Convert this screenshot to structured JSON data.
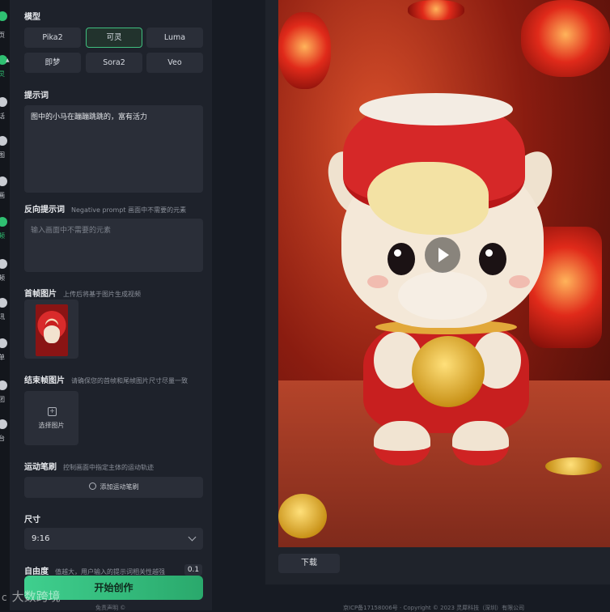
{
  "nav": {
    "items": [
      {
        "label": "页",
        "icon": "home-icon"
      },
      {
        "label": "灵",
        "icon": "video-icon",
        "active": true
      },
      {
        "label": "话",
        "icon": "chat-icon"
      },
      {
        "label": "图",
        "icon": "image-icon"
      },
      {
        "label": "画",
        "icon": "paint-icon"
      },
      {
        "label": "频",
        "icon": "film-icon",
        "active": true
      },
      {
        "label": "频",
        "icon": "audio-icon"
      },
      {
        "label": "讯",
        "icon": "news-icon"
      },
      {
        "label": "单",
        "icon": "list-icon"
      },
      {
        "label": "团",
        "icon": "team-icon"
      },
      {
        "label": "台",
        "icon": "platform-icon"
      }
    ]
  },
  "panel": {
    "model_title": "模型",
    "models": [
      "Pika2",
      "可灵",
      "Luma",
      "即梦",
      "Sora2",
      "Veo"
    ],
    "selected_model": "可灵",
    "prompt_title": "提示词",
    "prompt_value": "图中的小马在蹦蹦跳跳的，富有活力",
    "negative_title": "反向提示词",
    "negative_hint": "Negative prompt 画面中不需要的元素",
    "negative_placeholder": "输入画面中不需要的元素",
    "first_frame_title": "首帧图片",
    "first_frame_hint": "上传后将基于图片生成视频",
    "end_frame_title": "结束帧图片",
    "end_frame_hint": "请确保您的首帧和尾帧图片尺寸尽量一致",
    "upload_label": "选择图片",
    "brush_title": "运动笔刷",
    "brush_hint": "控制画面中指定主体的运动轨迹",
    "brush_button": "添加运动笔刷",
    "size_title": "尺寸",
    "size_value": "9:16",
    "freedom_title": "自由度",
    "freedom_hint": "值越大，用户输入的提示词相关性越强",
    "freedom_value": "0.1",
    "start_button": "开始创作",
    "footer_left": "免责声明 ©",
    "footer_right": "京ICP备17158006号 · Copyright © 2023 灵犀科技（深圳）有限公司"
  },
  "preview": {
    "download_label": "下载"
  },
  "watermark": {
    "logo": "c",
    "text": "大数跨境"
  },
  "colors": {
    "accent": "#3fcf8e",
    "panel": "#1e222b",
    "field": "#2a2e38"
  }
}
